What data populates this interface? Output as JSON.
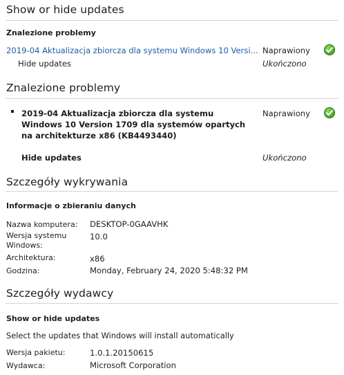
{
  "section1": {
    "title": "Show or hide updates",
    "subheading": "Znalezione problemy",
    "row1": {
      "link": "2019-04 Aktualizacja zbiorcza dla systemu Windows 10 Versi...",
      "status": "Naprawiony",
      "status_icon": "check-circle-icon",
      "status_color": "#4fae2c"
    },
    "row2": {
      "label": "Hide updates",
      "status": "Ukończono"
    }
  },
  "section2": {
    "title": "Znalezione problemy",
    "item": {
      "text": "2019-04 Aktualizacja zbiorcza dla systemu Windows 10 Version 1709 dla systemów opartych na architekturze x86 (KB4493440)",
      "status": "Naprawiony",
      "status_icon": "check-circle-icon"
    },
    "row2": {
      "label": "Hide updates",
      "status": "Ukończono"
    }
  },
  "section3": {
    "title": "Szczegóły wykrywania",
    "subheading": "Informacje o zbieraniu danych",
    "fields": [
      {
        "label": "Nazwa komputera:",
        "value": "DESKTOP-0GAAVHK"
      },
      {
        "label": "Wersja systemu Windows:",
        "value": "10.0"
      },
      {
        "label": "Architektura:",
        "value": "x86"
      },
      {
        "label": "Godzina:",
        "value": "Monday, February 24, 2020 5:48:32 PM"
      }
    ]
  },
  "section4": {
    "title": "Szczegóły wydawcy",
    "subheading": "Show or hide updates",
    "description": "Select the updates that Windows will install automatically",
    "fields": [
      {
        "label": "Wersja pakietu:",
        "value": "1.0.1.20150615"
      },
      {
        "label": "Wydawca:",
        "value": "Microsoft Corporation"
      }
    ]
  }
}
